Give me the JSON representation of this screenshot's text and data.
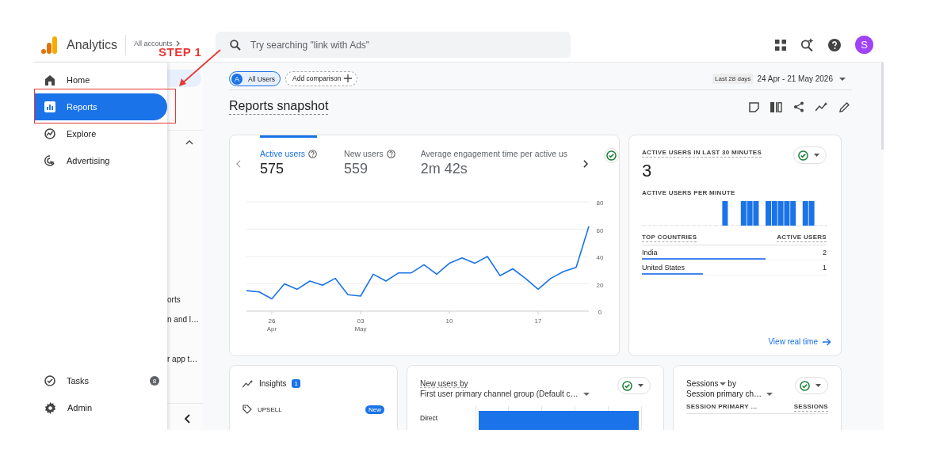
{
  "topbar": {
    "product": "Analytics",
    "account": "All accounts",
    "search": {
      "placeholder": "Try searching \"link with Ads\""
    },
    "avatar": "S"
  },
  "nav": {
    "items": [
      {
        "label": "Home",
        "selected": false
      },
      {
        "label": "Reports",
        "selected": true
      },
      {
        "label": "Explore",
        "selected": false
      },
      {
        "label": "Advertising",
        "selected": false
      }
    ],
    "bottom_items": [
      {
        "label": "Tasks",
        "badge": "8"
      },
      {
        "label": "Admin"
      }
    ]
  },
  "subnav": {
    "items": [
      "orts",
      "n and l…",
      "r app t…"
    ]
  },
  "annotation": {
    "label": "STEP 1"
  },
  "filters": {
    "chips": [
      {
        "label": "All Users",
        "avatar": "A",
        "kind": "filled"
      },
      {
        "label": "Add comparison",
        "kind": "dashed"
      }
    ],
    "range_label": "Last 28 days",
    "range": "24 Apr - 21 May 2026"
  },
  "title": "Reports snapshot",
  "overview": {
    "metrics": [
      {
        "label": "Active users",
        "value": "575",
        "help": true,
        "selected": true
      },
      {
        "label": "New users",
        "value": "559",
        "help": true,
        "selected": false
      },
      {
        "label": "Average engagement time per active us",
        "value": "2m 42s",
        "help": false,
        "selected": false
      }
    ],
    "chart_data": {
      "type": "line",
      "x": [
        "2026-04-24",
        "2026-04-25",
        "2026-04-26",
        "2026-04-27",
        "2026-04-28",
        "2026-04-29",
        "2026-04-30",
        "2026-05-01",
        "2026-05-02",
        "2026-05-03",
        "2026-05-04",
        "2026-05-05",
        "2026-05-06",
        "2026-05-07",
        "2026-05-08",
        "2026-05-09",
        "2026-05-10",
        "2026-05-11",
        "2026-05-12",
        "2026-05-13",
        "2026-05-14",
        "2026-05-15",
        "2026-05-16",
        "2026-05-17",
        "2026-05-18",
        "2026-05-19",
        "2026-05-20",
        "2026-05-21"
      ],
      "series": [
        {
          "color": "#1a73e8",
          "values": [
            15,
            14,
            9,
            20,
            16,
            22,
            19,
            24,
            12,
            11,
            27,
            22,
            28,
            28,
            34,
            27,
            35,
            39,
            35,
            40,
            26,
            31,
            24,
            16,
            24,
            29,
            32,
            62
          ]
        }
      ],
      "xlim": [
        "2026-04-24",
        "2026-05-21"
      ],
      "ylim": [
        0,
        80
      ],
      "yticks": [
        0,
        20,
        40,
        60,
        80
      ],
      "grid": true,
      "xticks": [
        {
          "value": "2026-04-26",
          "label": "26 Apr"
        },
        {
          "value": "2026-05-03",
          "label": "03 May"
        },
        {
          "value": "2026-05-10",
          "label": "10"
        },
        {
          "value": "2026-05-17",
          "label": "17"
        }
      ]
    }
  },
  "realtime": {
    "title": "ACTIVE USERS IN LAST 30 MINUTES",
    "value": "3",
    "per_minute_label": "ACTIVE USERS PER MINUTE",
    "columns": [
      "TOP COUNTRIES",
      "ACTIVE USERS"
    ],
    "rows": [
      {
        "country": "India",
        "users": "2",
        "level": 0.67
      },
      {
        "country": "United States",
        "users": "1",
        "level": 0.33
      }
    ],
    "link": "View real time"
  },
  "insights": {
    "title": "Insights",
    "badge": "1",
    "items": [
      {
        "label": "UPSELL",
        "tag": "New"
      }
    ]
  },
  "new_users": {
    "title": "New users by",
    "dimension": "First user primary channel group (Default c…",
    "rows": [
      "Direct"
    ]
  },
  "sessions": {
    "metric": "Sessions",
    "suffix": "by",
    "dimension": "Session primary ch…",
    "columns": [
      "SESSION PRIMARY …",
      "SESSIONS"
    ]
  }
}
